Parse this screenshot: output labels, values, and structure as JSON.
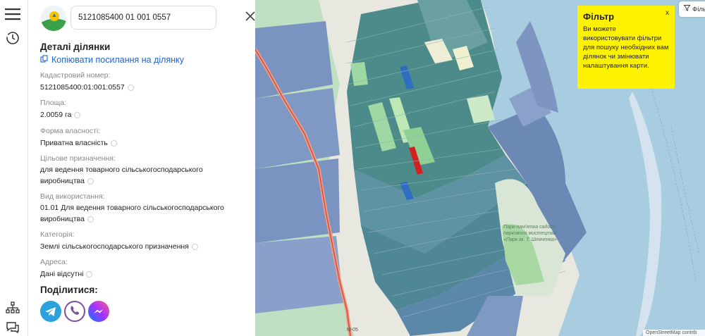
{
  "search": {
    "value": "5121085400 01 001 0557"
  },
  "details": {
    "title": "Деталі ділянки",
    "copy_link": "Копіювати посилання на ділянку",
    "fields": [
      {
        "label": "Кадастровий номер:",
        "value": "5121085400:01:001:0557"
      },
      {
        "label": "Площа:",
        "value": "2.0059 га"
      },
      {
        "label": "Форма власності:",
        "value": "Приватна власність"
      },
      {
        "label": "Цільове призначення:",
        "value": "для ведення товарного сільськогосподарського виробництва"
      },
      {
        "label": "Вид використання:",
        "value": "01.01 Для ведення товарного сільськогосподарського виробництва"
      },
      {
        "label": "Категорія:",
        "value": "Землі сільськогосподарського призначення"
      },
      {
        "label": "Адреса:",
        "value": "Дані відсутні"
      }
    ],
    "share_title": "Поділитися:"
  },
  "tooltip": {
    "title": "Фільтр",
    "text": "Ви можете використовувати фільтри для пошуку необхідних вам ділянок чи змінювати налаштування карти.",
    "close": "x"
  },
  "filter_button": "Фільт",
  "map": {
    "road_label": "М-05",
    "attribution": "OpenStreetMap contrib",
    "park_label": "Парк-пам'ятка садово-паркового мистецтва «Парк ім. Т. Шевченка»"
  },
  "colors": {
    "water": "#a9cde0",
    "parcel": "#4c8b8a",
    "selected": "#d62020",
    "tooltip": "#fff200",
    "link": "#2463c7"
  },
  "icons": [
    "menu-icon",
    "history-icon",
    "tree-icon",
    "chat-icon",
    "copy-icon",
    "close-icon",
    "filter-icon",
    "telegram-icon",
    "viber-icon",
    "messenger-icon"
  ]
}
